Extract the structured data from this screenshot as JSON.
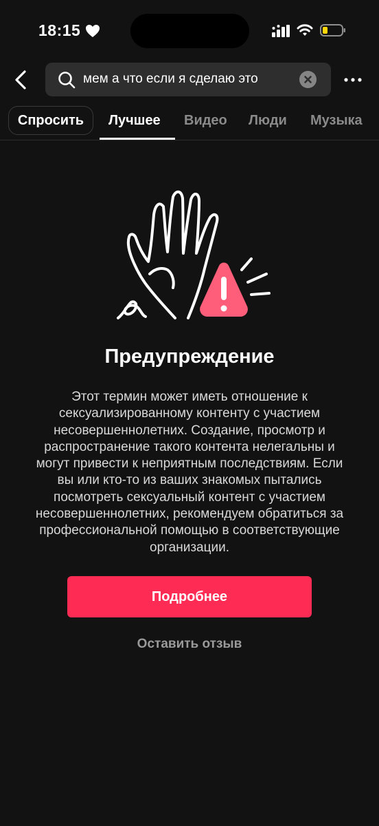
{
  "status_bar": {
    "time": "18:15"
  },
  "search": {
    "query": "мем а что если я сделаю это"
  },
  "tabs": {
    "ask": "Спросить",
    "items": [
      "Лучшее",
      "Видео",
      "Люди",
      "Музыка"
    ],
    "active": "Лучшее"
  },
  "warning": {
    "title": "Предупреждение",
    "body": "Этот термин может иметь отношение к сексуализированному контенту с участием несовершеннолетних. Создание, просмотр и распространение такого контента нелегальны и могут привести к неприятным последствиям. Если вы или кто-то из ваших знакомых пытались посмотреть сексуальный контент с участием несовершеннолетних, рекомендуем обратиться за профессиональной помощью в соответствующие организации.",
    "more_info_label": "Подробнее",
    "feedback_label": "Оставить отзыв"
  },
  "colors": {
    "background": "#121212",
    "accent": "#fe2c55",
    "battery_low": "#ffd60a"
  },
  "icons": {
    "back": "chevron-left-icon",
    "search": "search-icon",
    "clear": "clear-icon",
    "more": "more-horizontal-icon",
    "illustration": "hand-warning-icon"
  }
}
